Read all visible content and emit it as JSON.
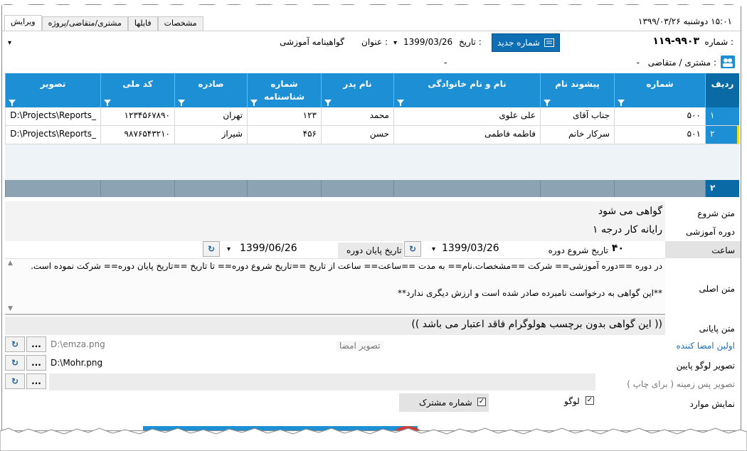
{
  "window": {
    "datetime_text": "۱۵:۰۱  دوشنبه  ۱۳۹۹/۰۳/۲۶",
    "tabs": [
      "ویرایش",
      "مشتری/متقاضی/پروژه",
      "فایلها",
      "مشخصات"
    ]
  },
  "header": {
    "number_label": "شماره :",
    "number_value": "۱۱۹-۹۹۰۳",
    "new_number_button": "شماره جدید",
    "date_label": "تاریخ :",
    "date_value": "1399/03/26",
    "title_label": "عنوان :",
    "title_value": "گواهینامه آموزشی",
    "customer_label": "مشتری / متقاضی :",
    "customer_value": "-",
    "customer_dash": "-"
  },
  "grid": {
    "columns": [
      "ردیف",
      "شماره",
      "پیشوند نام",
      "نام و نام خانوادگی",
      "نام پدر",
      "شماره شناسنامه",
      "صادره",
      "کد ملی",
      "تصویر"
    ],
    "rows": [
      {
        "row": "۱",
        "number": "۵۰۰",
        "prefix": "جناب آقای",
        "fullname": "علی علوی",
        "father": "محمد",
        "id_no": "۱۲۳",
        "issued": "تهران",
        "national": "۱۲۳۴۵۶۷۸۹۰",
        "image": "D:\\Projects\\Reports_"
      },
      {
        "row": "۲",
        "number": "۵۰۱",
        "prefix": "سرکار خانم",
        "fullname": "فاطمه فاطمی",
        "father": "حسن",
        "id_no": "۴۵۶",
        "issued": "شیراز",
        "national": "۹۸۷۶۵۴۳۲۱۰",
        "image": "D:\\Projects\\Reports_"
      }
    ],
    "footer_count": "۲"
  },
  "form": {
    "start_text_label": "متن شروع",
    "start_text_value": "گواهی می شود",
    "course_label": "دوره آموزشی",
    "course_value": "رایانه کار درجه ۱",
    "hours_label": "ساعت",
    "hours_value": "۴۰",
    "course_start_label": "تاریخ شروع دوره",
    "course_start_value": "1399/03/26",
    "course_end_label": "تاریخ پایان دوره",
    "course_end_value": "1399/06/26",
    "main_text_label": "متن اصلی",
    "main_text_line1": "در دوره ==دوره آموزشی== شرکت ==مشخصات.نام== به مدت ==ساعت== ساعت از تاریخ ==تاریخ شروع دوره== تا تاریخ ==تاریخ پایان دوره== شرکت نموده است.",
    "main_text_line2": "**این گواهی به درخواست نامبرده صادر شده است و ارزش دیگری ندارد**",
    "end_text_label": "متن پایانی",
    "end_text_value": "(( این گواهی بدون برچسب هولوگرام فاقد اعتبار می باشد ))",
    "first_signer_label": "اولین امضا کننده",
    "signature_image_label": "تصویر امضا",
    "signature_path": "D:\\emza.png",
    "logo_label": "تصویر لوگو پایین",
    "logo_path": "D:\\Mohr.png",
    "background_label": "تصویر پس زمینه ( برای چاپ )",
    "show_items_label": "نمایش موارد",
    "logo_check_label": "لوگو",
    "customer_no_check_label": "شماره مشترک",
    "browse_label": "...",
    "reset_icon": "refresh-icon"
  },
  "colors": {
    "accent": "#1d8fd4",
    "accent_dark": "#0a6aa6",
    "footer": "#8ba3b2",
    "link": "#1d6fb8"
  }
}
